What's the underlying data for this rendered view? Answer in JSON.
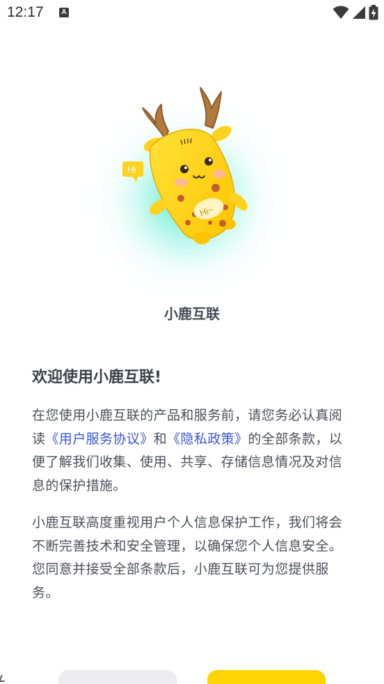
{
  "status_bar": {
    "time": "12:17",
    "notification_icon": "A",
    "icons": [
      "wifi-icon",
      "signal-icon",
      "battery-charging-icon"
    ]
  },
  "app": {
    "name": "小鹿互联",
    "mascot_bubble_text": "Hi",
    "mascot_belly_text": "Hi~"
  },
  "welcome": {
    "title": "欢迎使用小鹿互联!",
    "para1": {
      "text_before": "在您使用小鹿互联的产品和服务前，请您务必认真阅读",
      "link_terms": "《用户服务协议》",
      "text_and": "和",
      "link_privacy": "《隐私政策》",
      "text_after": "的全部条款，以便了解我们收集、使用、共享、存储信息情况及对信息的保护措施。"
    },
    "para2": "小鹿互联高度重视用户个人信息保护工作，我们将会不断完善技术和安全管理，以确保您个人信息安全。您同意并接受全部条款后，小鹿互联可为您提供服务。"
  },
  "buttons": {
    "decline_label": "",
    "agree_label": ""
  },
  "colors": {
    "link": "#3a56d6",
    "agree_button": "#ffd400",
    "decline_button": "#ececef",
    "mascot_yellow": "#ffd21f",
    "glow": "#3fe6c9"
  }
}
